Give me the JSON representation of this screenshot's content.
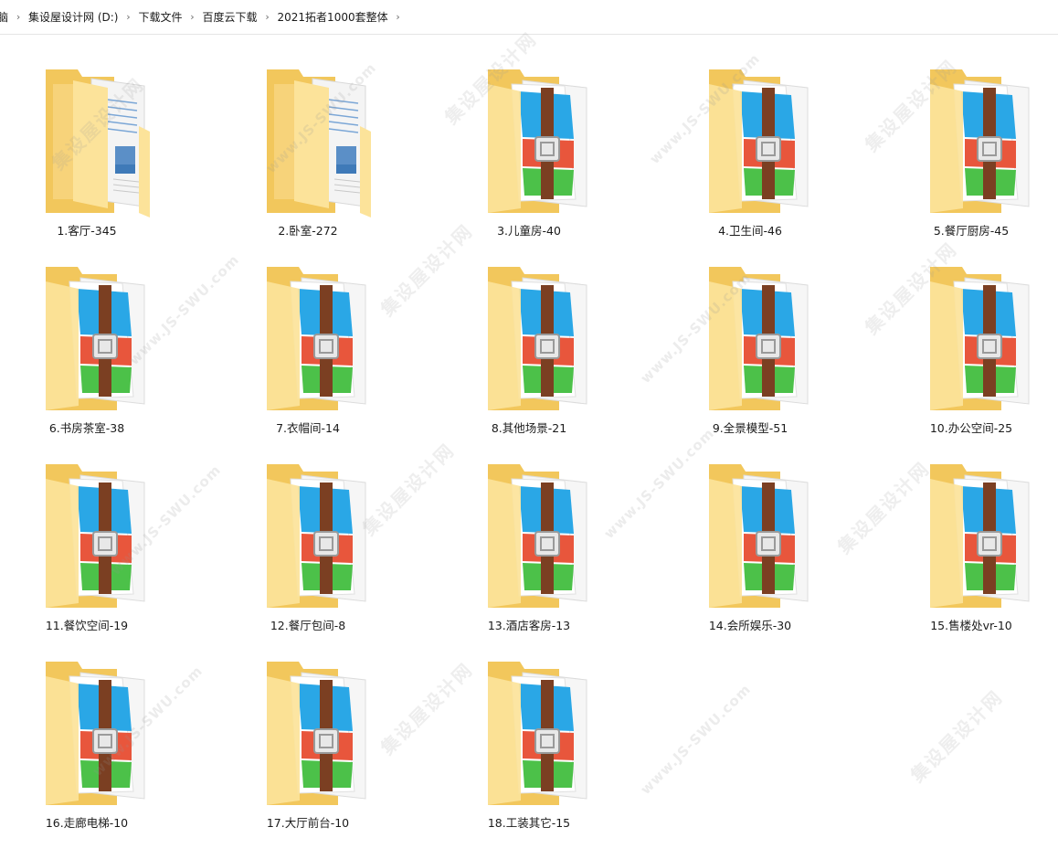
{
  "breadcrumb": [
    {
      "label": "脑"
    },
    {
      "label": "集设屋设计网 (D:)"
    },
    {
      "label": "下载文件"
    },
    {
      "label": "百度云下载"
    },
    {
      "label": "2021拓者1000套整体"
    }
  ],
  "items": [
    {
      "name": "1.客厅-345",
      "icon": "folder-icon"
    },
    {
      "name": "2.卧室-272",
      "icon": "folder-icon"
    },
    {
      "name": "3.儿童房-40",
      "icon": "archive-folder-icon"
    },
    {
      "name": "4.卫生间-46",
      "icon": "archive-folder-icon"
    },
    {
      "name": "5.餐厅厨房-45",
      "icon": "archive-folder-icon"
    },
    {
      "name": "6.书房茶室-38",
      "icon": "archive-folder-icon"
    },
    {
      "name": "7.衣帽间-14",
      "icon": "archive-folder-icon"
    },
    {
      "name": "8.其他场景-21",
      "icon": "archive-folder-icon"
    },
    {
      "name": "9.全景模型-51",
      "icon": "archive-folder-icon"
    },
    {
      "name": "10.办公空间-25",
      "icon": "archive-folder-icon"
    },
    {
      "name": "11.餐饮空间-19",
      "icon": "archive-folder-icon"
    },
    {
      "name": "12.餐厅包间-8",
      "icon": "archive-folder-icon"
    },
    {
      "name": "13.酒店客房-13",
      "icon": "archive-folder-icon"
    },
    {
      "name": "14.会所娱乐-30",
      "icon": "archive-folder-icon"
    },
    {
      "name": "15.售楼处vr-10",
      "icon": "archive-folder-icon"
    },
    {
      "name": "16.走廊电梯-10",
      "icon": "archive-folder-icon"
    },
    {
      "name": "17.大厅前台-10",
      "icon": "archive-folder-icon"
    },
    {
      "name": "18.工装其它-15",
      "icon": "archive-folder-icon"
    }
  ],
  "watermark": {
    "brand": "集设屋设计网",
    "url": "www.JS-SWU.com"
  },
  "colors": {
    "folder_back": "#f2c75c",
    "folder_front": "#fce39a",
    "archive_blue": "#2aa7e6",
    "archive_red": "#e8563c",
    "archive_green": "#4cc149",
    "archive_strap": "#7b3f22"
  }
}
